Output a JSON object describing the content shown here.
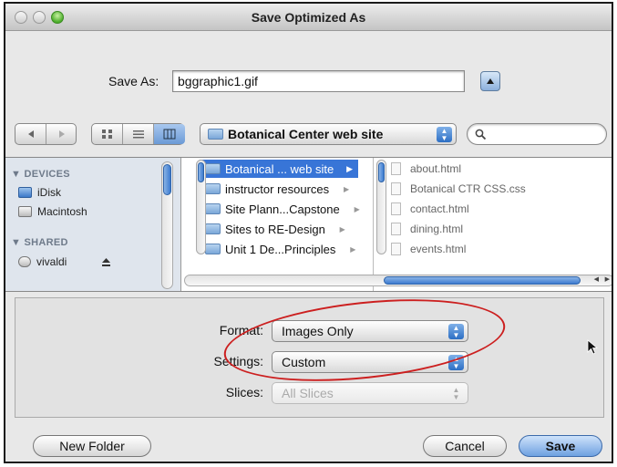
{
  "window": {
    "title": "Save Optimized As"
  },
  "save_as": {
    "label": "Save As:",
    "value": "bggraphic1.gif"
  },
  "toolbar": {
    "location": "Botanical Center web site",
    "search_placeholder": ""
  },
  "sidebar": {
    "devices_header": "DEVICES",
    "devices": [
      {
        "label": "iDisk"
      },
      {
        "label": "Macintosh"
      }
    ],
    "shared_header": "SHARED",
    "shared": [
      {
        "label": "vivaldi"
      }
    ]
  },
  "browser": {
    "folders": [
      {
        "label": "Botanical ... web site",
        "selected": true
      },
      {
        "label": "instructor resources"
      },
      {
        "label": "Site Plann...Capstone"
      },
      {
        "label": "Sites to RE-Design"
      },
      {
        "label": "Unit 1 De...Principles"
      }
    ],
    "files": [
      {
        "label": "about.html"
      },
      {
        "label": "Botanical CTR CSS.css"
      },
      {
        "label": "contact.html"
      },
      {
        "label": "dining.html"
      },
      {
        "label": "events.html"
      }
    ]
  },
  "options": {
    "format": {
      "label": "Format:",
      "value": "Images Only"
    },
    "settings": {
      "label": "Settings:",
      "value": "Custom"
    },
    "slices": {
      "label": "Slices:",
      "value": "All Slices"
    }
  },
  "buttons": {
    "new_folder": "New Folder",
    "cancel": "Cancel",
    "save": "Save"
  },
  "colors": {
    "selection": "#3875d7",
    "annotation": "#cc1f1f",
    "accent": "#6ea0e0"
  }
}
